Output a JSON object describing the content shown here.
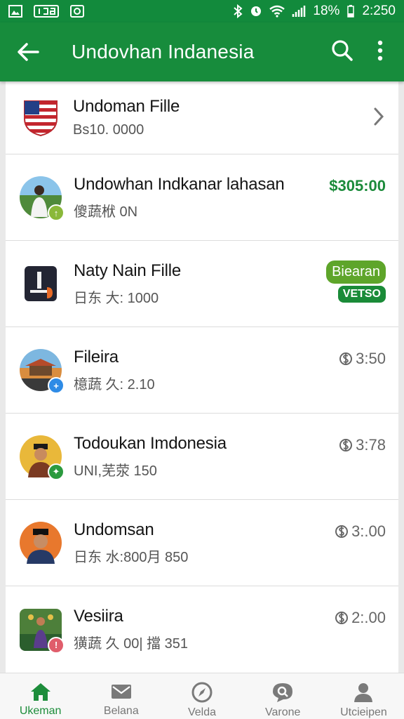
{
  "status": {
    "battery": "18%",
    "time": "2:250"
  },
  "app_bar": {
    "title": "Undovhan Indanesia"
  },
  "rows": [
    {
      "title": "Undoman  Fille",
      "subtitle": "Bs10. 0000"
    },
    {
      "title": "Undowhan Indkanar lahasan",
      "subtitle": "傻蔬栿 0N",
      "right": "$305:00"
    },
    {
      "title": "Naty Nain Fille",
      "subtitle": "日东 大: 1000",
      "pill": "Biearan",
      "pill_small": "VETSO"
    },
    {
      "title": "Fileira",
      "subtitle": "檍蔬 久: 2.10",
      "right": "3:50"
    },
    {
      "title": "Todoukan Imdonesia",
      "subtitle": "UNI,芜荥 150",
      "right": "3:78"
    },
    {
      "title": "Undomsan",
      "subtitle": "日东 水:800月 850",
      "right": "3:.00"
    },
    {
      "title": "Vesiira",
      "subtitle": "獚蔬 久  00|  擋 351",
      "right": "2:.00"
    }
  ],
  "bottom_nav": [
    {
      "label": "Ukeman"
    },
    {
      "label": "Belana"
    },
    {
      "label": "Velda"
    },
    {
      "label": "Varone"
    },
    {
      "label": "Utcieipen"
    }
  ],
  "colors": {
    "app_bar": "#178c3c",
    "status_bar": "#128a3c",
    "accent": "#1d8d3b",
    "pill": "#5ea52a"
  },
  "icons": [
    "back-arrow-icon",
    "search-icon",
    "more-vert-icon",
    "home-icon",
    "mail-icon",
    "compass-icon",
    "chat-search-icon",
    "person-icon"
  ]
}
